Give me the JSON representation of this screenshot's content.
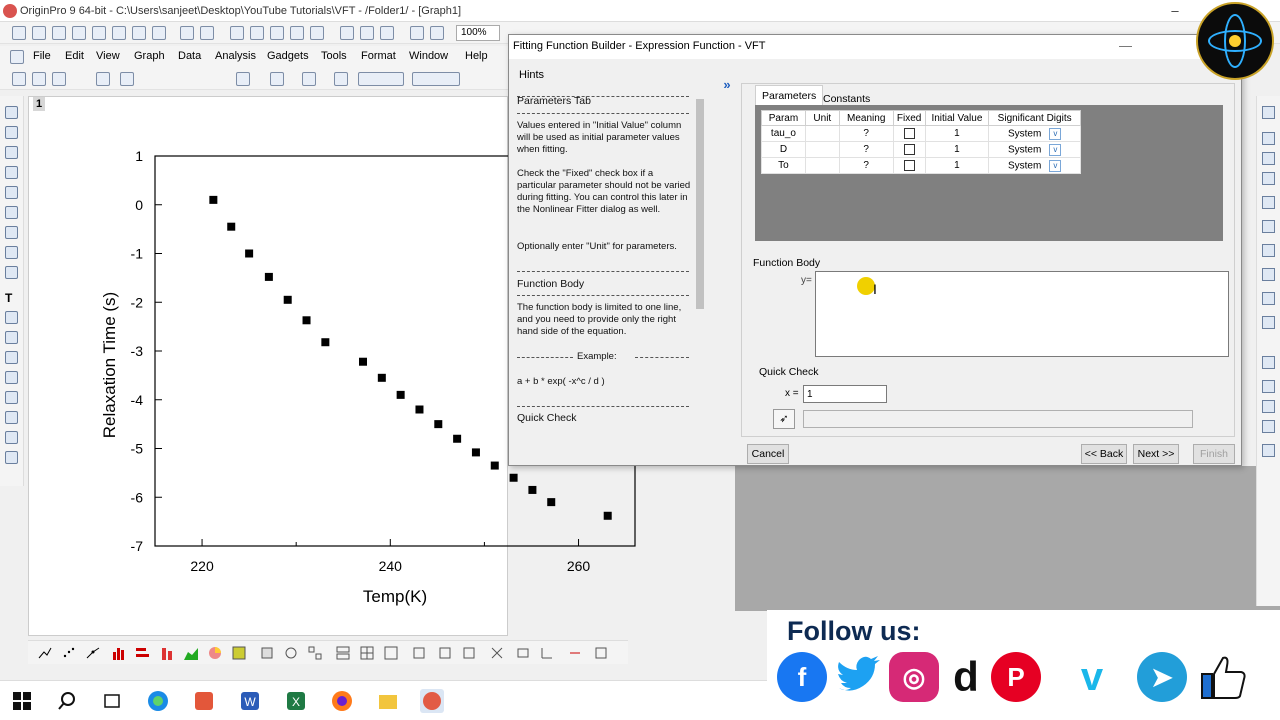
{
  "window": {
    "title": "OriginPro 9 64-bit - C:\\Users\\sanjeet\\Desktop\\YouTube Tutorials\\VFT - /Folder1/ - [Graph1]",
    "zoom": "100%"
  },
  "menu": [
    "File",
    "Edit",
    "View",
    "Graph",
    "Data",
    "Analysis",
    "Gadgets",
    "Tools",
    "Format",
    "Window",
    "Help"
  ],
  "graph": {
    "layer_number": "1",
    "chart_data": {
      "type": "scatter",
      "x": [
        221.2,
        223.1,
        225.0,
        227.1,
        229.1,
        231.1,
        233.1,
        237.1,
        239.1,
        241.1,
        243.1,
        245.1,
        247.1,
        249.1,
        251.1,
        253.1,
        255.1,
        257.1,
        263.1
      ],
      "y": [
        0.1,
        -0.45,
        -1.0,
        -1.48,
        -1.95,
        -2.37,
        -2.82,
        -3.22,
        -3.55,
        -3.9,
        -4.2,
        -4.5,
        -4.8,
        -5.08,
        -5.35,
        -5.6,
        -5.85,
        -6.1,
        -6.38
      ],
      "xlabel": "Temp(K)",
      "ylabel": "Relaxation Time (s)",
      "xlim": [
        215,
        266
      ],
      "ylim": [
        -7,
        1
      ],
      "xticks": [
        "220",
        "240",
        "260"
      ],
      "yticks": [
        "1",
        "0",
        "-1",
        "-2",
        "-3",
        "-4",
        "-5",
        "-6",
        "-7"
      ],
      "marker": "square",
      "color": "#000000"
    }
  },
  "dialog": {
    "title": "Fitting Function Builder - Expression Function - VFT",
    "hints_label": "Hints",
    "hints": {
      "params_head": "Parameters Tab",
      "params_p1": "Values entered in \"Initial Value\" column will be used as initial parameter values when fitting.",
      "params_p2": "Check the \"Fixed\" check box if a particular parameter should not be varied during fitting. You can control this later in the Nonlinear Fitter dialog as well.",
      "params_p3": "Optionally enter \"Unit\" for parameters.",
      "body_head": "Function Body",
      "body_p1": "The function body is limited to one line, and you need to provide only the right hand side of the equation.",
      "example_label": "Example:",
      "example": "a + b * exp( -x^c / d )",
      "qc_head": "Quick Check"
    },
    "tabs": [
      "Parameters",
      "Constants"
    ],
    "table": {
      "headers": [
        "Param",
        "Unit",
        "Meaning",
        "Fixed",
        "Initial Value",
        "Significant Digits"
      ],
      "rows": [
        {
          "param": "tau_o",
          "unit": "",
          "meaning": "?",
          "initial": "1",
          "digits": "System"
        },
        {
          "param": "D",
          "unit": "",
          "meaning": "?",
          "initial": "1",
          "digits": "System"
        },
        {
          "param": "To",
          "unit": "",
          "meaning": "?",
          "initial": "1",
          "digits": "System"
        }
      ]
    },
    "function_body_label": "Function Body",
    "y_label": "y=",
    "quick_check_label": "Quick Check",
    "x_label": "x =",
    "x_value": "1",
    "buttons": {
      "cancel": "Cancel",
      "back": "<< Back",
      "next": "Next >>",
      "finish": "Finish"
    }
  },
  "banner": {
    "follow_text": "Follow us:",
    "colors": {
      "facebook": "#1877f2",
      "twitter": "#1da1f2",
      "instagram": "#d62976",
      "dailymotion": "#111111",
      "pinterest": "#e60023",
      "vimeo": "#1ab7ea",
      "telegram": "#229ed9",
      "like": "#1f6fd1"
    }
  }
}
